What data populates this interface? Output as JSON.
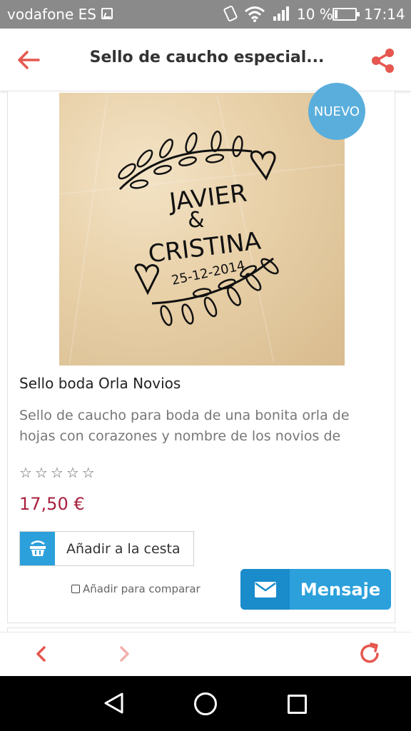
{
  "status_bar": {
    "carrier": "vodafone ES",
    "battery": "10 %",
    "time": "17:14"
  },
  "app_bar": {
    "title": "Sello de caucho especial..."
  },
  "product": {
    "badge": "NUEVO",
    "image_text": {
      "name1": "JAVIER",
      "ampersand": "&",
      "name2": "CRISTINA",
      "date": "25-12-2014"
    },
    "title": "Sello boda Orla Novios",
    "description": "Sello de caucho para boda de una bonita orla de hojas con corazones y nombre de los novios de",
    "rating": {
      "value": 0,
      "max": 5,
      "star_glyph": "☆"
    },
    "price": "17,50 €",
    "add_to_cart": "Añadir a la cesta",
    "compare": "Añadir para comparar",
    "message": "Mensaje"
  },
  "colors": {
    "accent_red": "#e5574f",
    "accent_blue": "#2ba0db",
    "price": "#a8203e",
    "badge": "#5aaedc"
  },
  "icons": {
    "back": "arrow-left-icon",
    "share": "share-icon",
    "basket": "basket-icon",
    "mail": "mail-icon",
    "prev": "chevron-left-icon",
    "next": "chevron-right-icon",
    "refresh": "refresh-icon"
  }
}
